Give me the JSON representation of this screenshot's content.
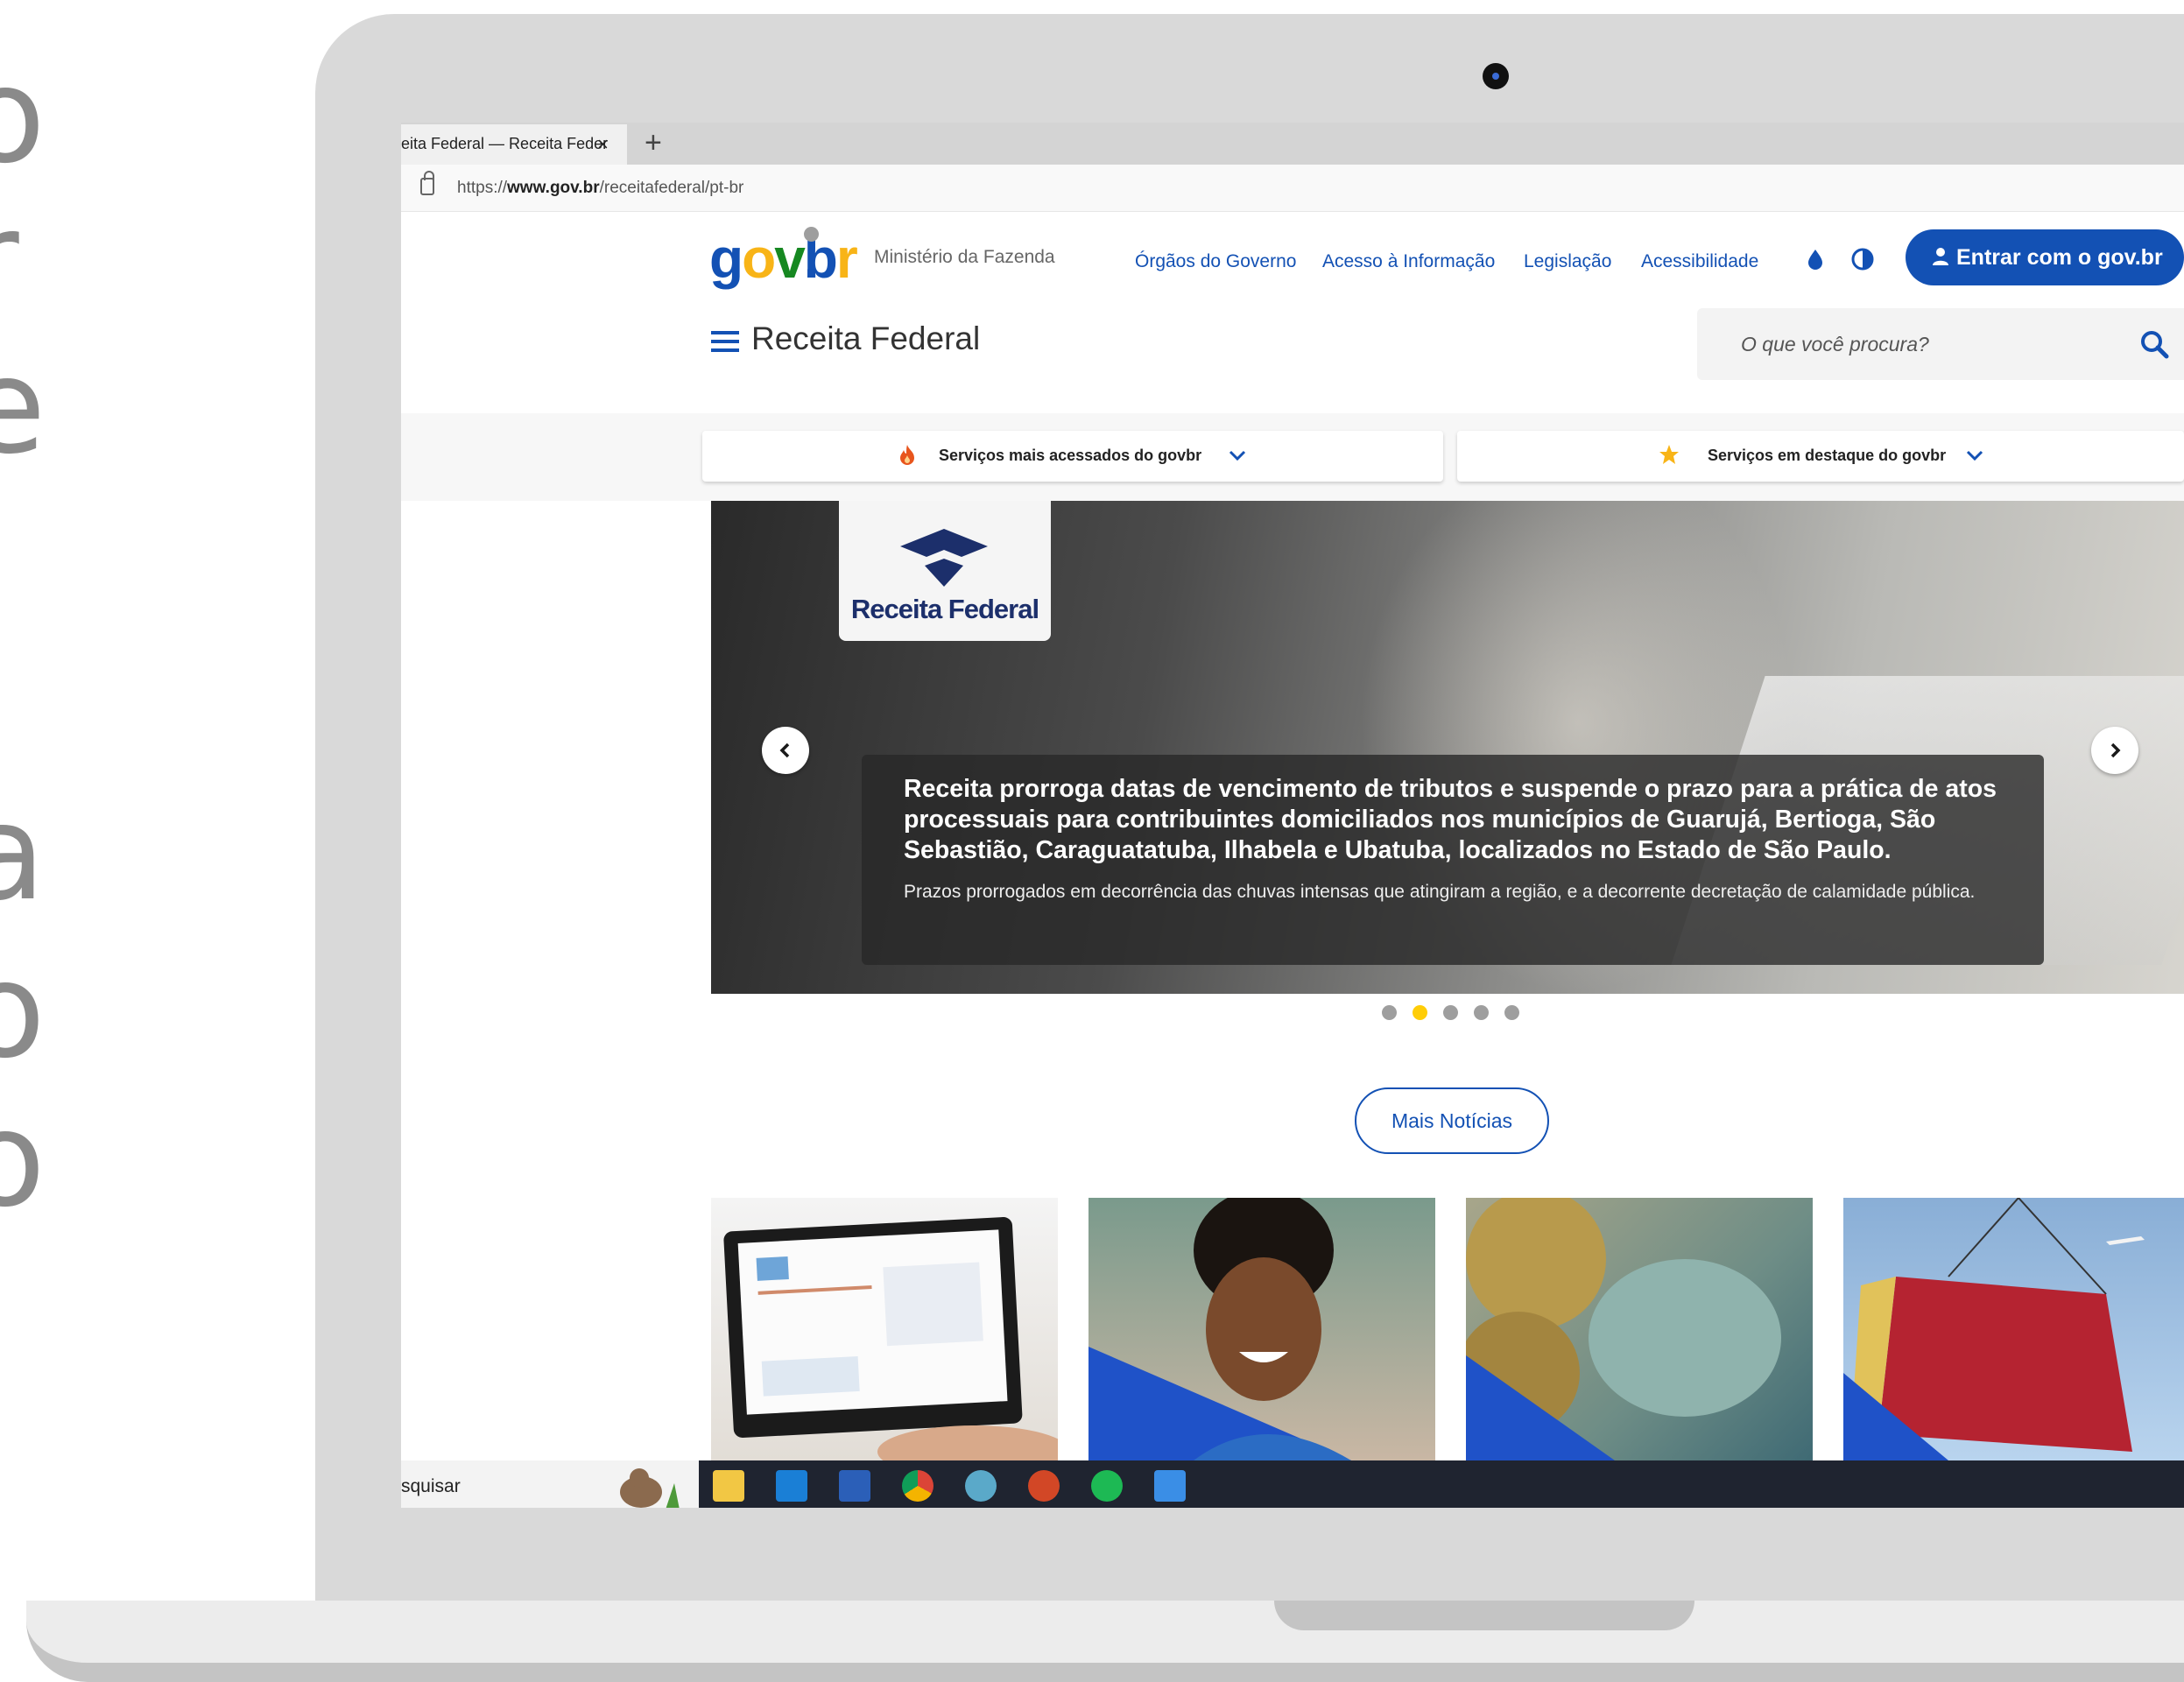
{
  "edge_letters": [
    "o",
    "r",
    "e",
    "a",
    "o",
    "o"
  ],
  "browser": {
    "tab_title": "eita Federal — Receita Feder",
    "tab_close": "×",
    "new_tab": "+",
    "url_prefix": "https://",
    "url_domain": "www.gov.br",
    "url_path": "/receitafederal/pt-br"
  },
  "header": {
    "logo": {
      "g": "g",
      "o": "o",
      "v": "v",
      "dot": ".",
      "b": "b",
      "r": "r"
    },
    "ministry": "Ministério da Fazenda",
    "nav": [
      "Órgãos do Governo",
      "Acesso à Informação",
      "Legislação",
      "Acessibilidade"
    ],
    "login_label": "Entrar com o gov.br",
    "site_title": "Receita Federal",
    "search_placeholder": "O que você procura?"
  },
  "services": {
    "most_accessed": "Serviços mais acessados do govbr",
    "featured": "Serviços em destaque do govbr"
  },
  "hero": {
    "logo_text": "Receita Federal",
    "headline": "Receita prorroga datas de vencimento de tributos e suspende o prazo para a prática de atos processuais para contribuintes domiciliados nos municípios de Guarujá, Bertioga, São Sebastião, Caraguatatuba, Ilhabela e Ubatuba, localizados no Estado de São Paulo.",
    "subtext": "Prazos prorrogados em decorrência das chuvas intensas que atingiram a região, e a decorrente decretação de calamidade pública.",
    "slide_count": 5,
    "active_slide": 2
  },
  "more_news": "Mais Notícias",
  "taskbar": {
    "search_text": "squisar"
  },
  "colors": {
    "brand_blue": "#1351b4",
    "brand_yellow": "#f8b417",
    "brand_green": "#168821",
    "active_dot": "#ffcd07"
  }
}
